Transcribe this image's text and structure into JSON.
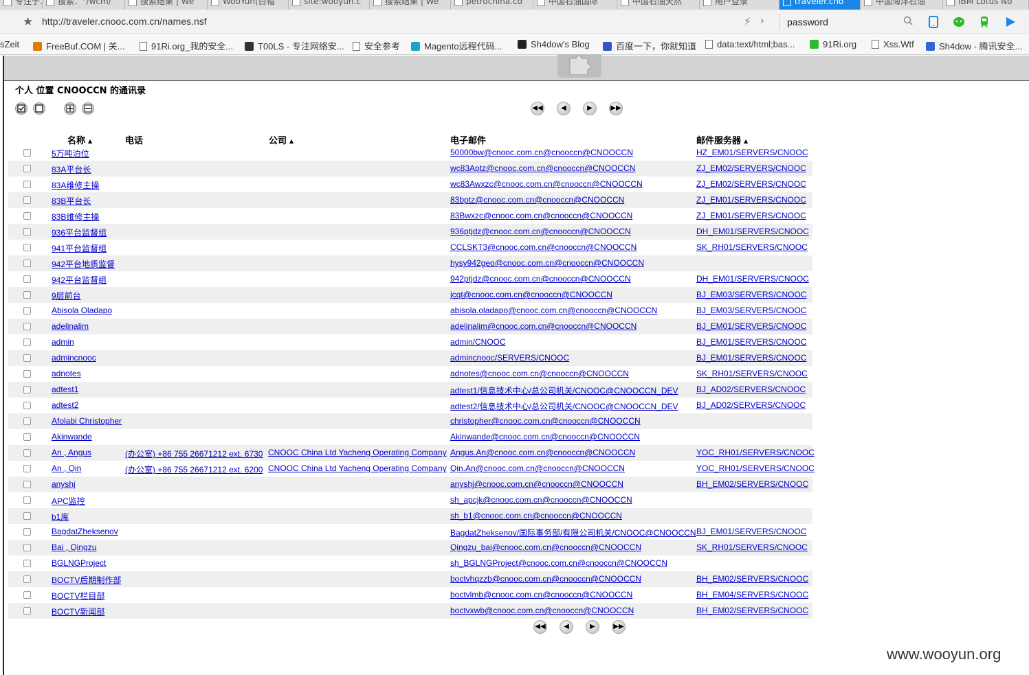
{
  "browser": {
    "tabs": [
      {
        "title": "专注于...",
        "active": false
      },
      {
        "title": "搜索：\"/wcm/",
        "active": false
      },
      {
        "title": "搜索结果 | We",
        "active": false
      },
      {
        "title": "WooYun(白帽",
        "active": false
      },
      {
        "title": "site:wooyun.c",
        "active": false
      },
      {
        "title": "搜索结果 | We",
        "active": false
      },
      {
        "title": "petrochina.co",
        "active": false
      },
      {
        "title": "中国石油国际",
        "active": false
      },
      {
        "title": "中国石油天然",
        "active": false
      },
      {
        "title": "用户登录",
        "active": false
      },
      {
        "title": "traveler.cno",
        "active": true
      },
      {
        "title": "中国海洋石油",
        "active": false
      },
      {
        "title": "IBM Lotus No",
        "active": false
      }
    ],
    "url": "http://traveler.cnooc.com.cn/names.nsf",
    "search_value": "password",
    "bookmarks": [
      "sZeit",
      "FreeBuf.COM | 关...",
      "91Ri.org_我的安全...",
      "T00LS - 专注网络安...",
      "安全参考",
      "Magento远程代码...",
      "Sh4dow's Blog",
      "百度一下，你就知道",
      "data:text/html;bas...",
      "91Ri.org",
      "Xss.Wtf",
      "Sh4dow - 腾讯安全..."
    ]
  },
  "page": {
    "title": "个人 位置 CNOOCCN 的通讯录",
    "columns": {
      "name": "名称",
      "phone": "电话",
      "company": "公司",
      "email": "电子邮件",
      "server": "邮件服务器"
    },
    "rows": [
      {
        "name": "5万吨泊位",
        "phone": "",
        "company": "",
        "email": "50000bw@cnooc.com.cn@cnooccn@CNOOCCN",
        "server": "HZ_EM01/SERVERS/CNOOC"
      },
      {
        "name": "83A平台长",
        "phone": "",
        "company": "",
        "email": "wc83Aptz@cnooc.com.cn@cnooccn@CNOOCCN",
        "server": "ZJ_EM02/SERVERS/CNOOC"
      },
      {
        "name": "83A维修主操",
        "phone": "",
        "company": "",
        "email": "wc83Awxzc@cnooc.com.cn@cnooccn@CNOOCCN",
        "server": "ZJ_EM02/SERVERS/CNOOC"
      },
      {
        "name": "83B平台长",
        "phone": "",
        "company": "",
        "email": "83bptz@cnooc.com.cn@cnooccn@CNOOCCN",
        "server": "ZJ_EM01/SERVERS/CNOOC"
      },
      {
        "name": "83B维修主操",
        "phone": "",
        "company": "",
        "email": "83Bwxzc@cnooc.com.cn@cnooccn@CNOOCCN",
        "server": "ZJ_EM01/SERVERS/CNOOC"
      },
      {
        "name": "936平台监督组",
        "phone": "",
        "company": "",
        "email": "936ptjdz@cnooc.com.cn@cnooccn@CNOOCCN",
        "server": "DH_EM01/SERVERS/CNOOC"
      },
      {
        "name": "941平台监督组",
        "phone": "",
        "company": "",
        "email": "CCLSKT3@cnooc.com.cn@cnooccn@CNOOCCN",
        "server": "SK_RH01/SERVERS/CNOOC"
      },
      {
        "name": "942平台地质监督",
        "phone": "",
        "company": "",
        "email": "hysy942geo@cnooc.com.cn@cnooccn@CNOOCCN",
        "server": ""
      },
      {
        "name": "942平台监督组",
        "phone": "",
        "company": "",
        "email": "942ptjdz@cnooc.com.cn@cnooccn@CNOOCCN",
        "server": "DH_EM01/SERVERS/CNOOC"
      },
      {
        "name": "9层前台",
        "phone": "",
        "company": "",
        "email": "jcqt@cnooc.com.cn@cnooccn@CNOOCCN",
        "server": "BJ_EM03/SERVERS/CNOOC"
      },
      {
        "name": "Abisola Oladapo",
        "phone": "",
        "company": "",
        "email": "abisola.oladapo@cnooc.com.cn@cnooccn@CNOOCCN",
        "server": "BJ_EM03/SERVERS/CNOOC"
      },
      {
        "name": "adelinalim",
        "phone": "",
        "company": "",
        "email": "adelinalim@cnooc.com.cn@cnooccn@CNOOCCN",
        "server": "BJ_EM01/SERVERS/CNOOC"
      },
      {
        "name": "admin",
        "phone": "",
        "company": "",
        "email": "admin/CNOOC",
        "server": "BJ_EM01/SERVERS/CNOOC"
      },
      {
        "name": "admincnooc",
        "phone": "",
        "company": "",
        "email": "admincnooc/SERVERS/CNOOC",
        "server": "BJ_EM01/SERVERS/CNOOC"
      },
      {
        "name": "adnotes",
        "phone": "",
        "company": "",
        "email": "adnotes@cnooc.com.cn@cnooccn@CNOOCCN",
        "server": "SK_RH01/SERVERS/CNOOC"
      },
      {
        "name": "adtest1",
        "phone": "",
        "company": "",
        "email": "adtest1/信息技术中心/总公司机关/CNOOC@CNOOCCN_DEV",
        "server": "BJ_AD02/SERVERS/CNOOC"
      },
      {
        "name": "adtest2",
        "phone": "",
        "company": "",
        "email": "adtest2/信息技术中心/总公司机关/CNOOC@CNOOCCN_DEV",
        "server": "BJ_AD02/SERVERS/CNOOC"
      },
      {
        "name": "Afolabi Christopher",
        "phone": "",
        "company": "",
        "email": "christopher@cnooc.com.cn@cnooccn@CNOOCCN",
        "server": ""
      },
      {
        "name": "Akinwande",
        "phone": "",
        "company": "",
        "email": "Akinwande@cnooc.com.cn@cnooccn@CNOOCCN",
        "server": ""
      },
      {
        "name": "An , Angus",
        "phone": "(办公室) +86 755 26671212 ext. 6730",
        "company": "CNOOC China Ltd Yacheng Operating Company",
        "email": "Angus.An@cnooc.com.cn@cnooccn@CNOOCCN",
        "server": "YOC_RH01/SERVERS/CNOOC"
      },
      {
        "name": "An , Qin",
        "phone": "(办公室) +86 755 26671212 ext. 6200",
        "company": "CNOOC China Ltd Yacheng Operating Company",
        "email": "Qin.An@cnooc.com.cn@cnooccn@CNOOCCN",
        "server": "YOC_RH01/SERVERS/CNOOC"
      },
      {
        "name": "anyshj",
        "phone": "",
        "company": "",
        "email": "anyshj@cnooc.com.cn@cnooccn@CNOOCCN",
        "server": "BH_EM02/SERVERS/CNOOC"
      },
      {
        "name": "APC监控",
        "phone": "",
        "company": "",
        "email": "sh_apcjk@cnooc.com.cn@cnooccn@CNOOCCN",
        "server": ""
      },
      {
        "name": "b1库",
        "phone": "",
        "company": "",
        "email": "sh_b1@cnooc.com.cn@cnooccn@CNOOCCN",
        "server": ""
      },
      {
        "name": "BagdatZheksenov",
        "phone": "",
        "company": "",
        "email": "BagdatZheksenov/国际事务部/有限公司机关/CNOOC@CNOOCCN",
        "server": "BJ_EM01/SERVERS/CNOOC"
      },
      {
        "name": "Bai , Qingzu",
        "phone": "",
        "company": "",
        "email": "Qingzu_bai@cnooc.com.cn@cnooccn@CNOOCCN",
        "server": "SK_RH01/SERVERS/CNOOC"
      },
      {
        "name": "BGLNGProject",
        "phone": "",
        "company": "",
        "email": "sh_BGLNGProject@cnooc.com.cn@cnooccn@CNOOCCN",
        "server": ""
      },
      {
        "name": "BOCTV后期制作部",
        "phone": "",
        "company": "",
        "email": "boctvhqzzb@cnooc.com.cn@cnooccn@CNOOCCN",
        "server": "BH_EM02/SERVERS/CNOOC"
      },
      {
        "name": "BOCTV栏目部",
        "phone": "",
        "company": "",
        "email": "boctvlmb@cnooc.com.cn@cnooccn@CNOOCCN",
        "server": "BH_EM04/SERVERS/CNOOC"
      },
      {
        "name": "BOCTV新闻部",
        "phone": "",
        "company": "",
        "email": "boctvxwb@cnooc.com.cn@cnooccn@CNOOCCN",
        "server": "BH_EM02/SERVERS/CNOOC"
      }
    ]
  },
  "nav_glyphs": {
    "first": "◀◀",
    "prev": "◀",
    "next": "▶",
    "last": "▶▶"
  },
  "watermark": "www.wooyun.org"
}
